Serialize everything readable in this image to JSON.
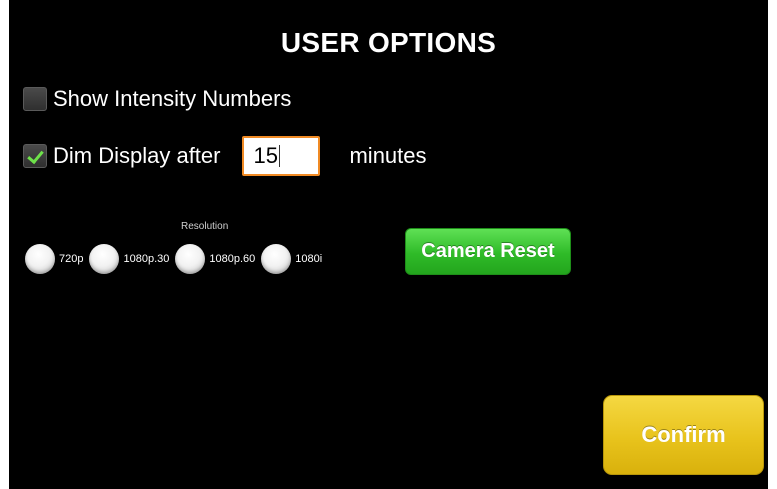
{
  "title": "USER OPTIONS",
  "show_intensity": {
    "label": "Show Intensity Numbers",
    "checked": false
  },
  "dim_display": {
    "label": "Dim Display after",
    "checked": true,
    "value": "15",
    "unit": "minutes"
  },
  "resolution": {
    "title": "Resolution",
    "options": [
      {
        "label": "720p",
        "selected": false
      },
      {
        "label": "1080p.30",
        "selected": false
      },
      {
        "label": "1080p.60",
        "selected": false
      },
      {
        "label": "1080i",
        "selected": false
      }
    ]
  },
  "camera_reset_label": "Camera Reset",
  "confirm_label": "Confirm",
  "colors": {
    "background": "#000000",
    "check_accent": "#6ee14a",
    "input_border": "#f08a24",
    "camera_reset": "#2fbb28",
    "confirm": "#e8c31c"
  }
}
